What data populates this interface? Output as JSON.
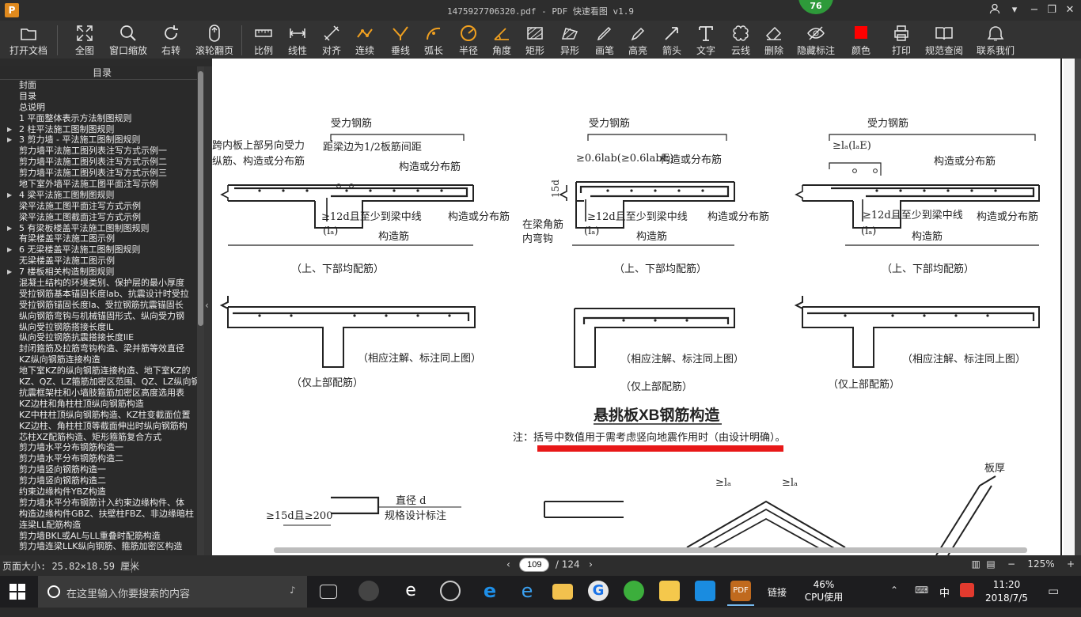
{
  "window": {
    "title": "1475927706320.pdf - PDF 快速看图 v1.9",
    "logo_letter": "P",
    "badge": "76"
  },
  "toolbar": [
    {
      "label": "打开文档",
      "icon": "folder-icon"
    },
    {
      "label": "全图",
      "icon": "fullscreen-icon"
    },
    {
      "label": "窗口缩放",
      "icon": "magnifier-icon"
    },
    {
      "label": "右转",
      "icon": "rotate-right-icon"
    },
    {
      "label": "滚轮翻页",
      "icon": "mouse-wheel-icon"
    },
    {
      "label": "比例",
      "icon": "scale-ruler-icon"
    },
    {
      "label": "线性",
      "icon": "linear-dimension-icon"
    },
    {
      "label": "对齐",
      "icon": "aligned-dimension-icon"
    },
    {
      "label": "连续",
      "icon": "continuous-dimension-icon"
    },
    {
      "label": "垂线",
      "icon": "perpendicular-icon"
    },
    {
      "label": "弧长",
      "icon": "arc-length-icon"
    },
    {
      "label": "半径",
      "icon": "radius-icon"
    },
    {
      "label": "角度",
      "icon": "angle-icon"
    },
    {
      "label": "矩形",
      "icon": "rectangle-area-icon"
    },
    {
      "label": "异形",
      "icon": "polygon-area-icon"
    },
    {
      "label": "画笔",
      "icon": "pen-icon"
    },
    {
      "label": "高亮",
      "icon": "highlighter-icon"
    },
    {
      "label": "箭头",
      "icon": "arrow-icon"
    },
    {
      "label": "文字",
      "icon": "text-icon"
    },
    {
      "label": "云线",
      "icon": "cloud-line-icon"
    },
    {
      "label": "删除",
      "icon": "eraser-icon"
    },
    {
      "label": "隐藏标注",
      "icon": "hide-eye-icon"
    },
    {
      "label": "颜色",
      "icon": "color-swatch-icon",
      "color": "#ff0000"
    },
    {
      "label": "打印",
      "icon": "printer-icon"
    },
    {
      "label": "规范查阅",
      "icon": "book-icon"
    },
    {
      "label": "联系我们",
      "icon": "contact-icon"
    }
  ],
  "sidebar": {
    "title": "目录",
    "items": [
      {
        "label": "封面",
        "expandable": false
      },
      {
        "label": "目录",
        "expandable": false
      },
      {
        "label": "总说明",
        "expandable": false
      },
      {
        "label": "1 平面整体表示方法制图规则",
        "expandable": false
      },
      {
        "label": "2 柱平法施工图制图规则",
        "expandable": true
      },
      {
        "label": "3 剪力墙 - 平法施工图制图规则",
        "expandable": true
      },
      {
        "label": "剪力墙平法施工图列表注写方式示例一",
        "expandable": false
      },
      {
        "label": "剪力墙平法施工图列表注写方式示例二",
        "expandable": false
      },
      {
        "label": "剪力墙平法施工图列表注写方式示例三",
        "expandable": false
      },
      {
        "label": "地下室外墙平法施工图平面注写示例",
        "expandable": false
      },
      {
        "label": "4 梁平法施工图制图规则",
        "expandable": true
      },
      {
        "label": "梁平法施工图平面注写方式示例",
        "expandable": false
      },
      {
        "label": "梁平法施工图截面注写方式示例",
        "expandable": false
      },
      {
        "label": "5 有梁板楼盖平法施工图制图规则",
        "expandable": true
      },
      {
        "label": "有梁楼盖平法施工图示例",
        "expandable": false
      },
      {
        "label": "6 无梁楼盖平法施工图制图规则",
        "expandable": true
      },
      {
        "label": "无梁楼盖平法施工图示例",
        "expandable": false
      },
      {
        "label": "7 楼板相关构造制图规则",
        "expandable": true
      },
      {
        "label": "混凝土结构的环境类别、保护层的最小厚度",
        "expandable": false
      },
      {
        "label": "受拉钢筋基本锚固长度lab、抗震设计时受拉",
        "expandable": false
      },
      {
        "label": "受拉钢筋锚固长度la、受拉钢筋抗震锚固长",
        "expandable": false
      },
      {
        "label": "纵向钢筋弯钩与机械锚固形式、纵向受力钢",
        "expandable": false
      },
      {
        "label": "纵向受拉钢筋搭接长度lL",
        "expandable": false
      },
      {
        "label": "纵向受拉钢筋抗震搭接长度llE",
        "expandable": false
      },
      {
        "label": "封闭箍筋及拉筋弯钩构造、梁并筋等效直径",
        "expandable": false
      },
      {
        "label": "KZ纵向钢筋连接构造",
        "expandable": false
      },
      {
        "label": "地下室KZ的纵向钢筋连接构造、地下室KZ的",
        "expandable": false
      },
      {
        "label": "KZ、QZ、LZ箍筋加密区范围、QZ、LZ纵向钢",
        "expandable": false
      },
      {
        "label": "抗震框架柱和小墙肢箍筋加密区高度选用表",
        "expandable": false
      },
      {
        "label": "KZ边柱和角柱柱顶纵向钢筋构造",
        "expandable": false
      },
      {
        "label": "KZ中柱柱顶纵向钢筋构造、KZ柱变截面位置",
        "expandable": false
      },
      {
        "label": "KZ边柱、角柱柱顶等截面伸出时纵向钢筋构",
        "expandable": false
      },
      {
        "label": "芯柱XZ配筋构造、矩形箍筋复合方式",
        "expandable": false
      },
      {
        "label": "剪力墙水平分布钢筋构造一",
        "expandable": false
      },
      {
        "label": "剪力墙水平分布钢筋构造二",
        "expandable": false
      },
      {
        "label": "剪力墙竖向钢筋构造一",
        "expandable": false
      },
      {
        "label": "剪力墙竖向钢筋构造二",
        "expandable": false
      },
      {
        "label": "约束边缘构件YBZ构造",
        "expandable": false
      },
      {
        "label": "剪力墙水平分布钢筋计入约束边缘构件、体",
        "expandable": false
      },
      {
        "label": "构造边缘构件GBZ、扶壁柱FBZ、非边缘暗柱",
        "expandable": false
      },
      {
        "label": "连梁LL配筋构造",
        "expandable": false
      },
      {
        "label": "剪力墙BKL或AL与LL重叠时配筋构造",
        "expandable": false
      },
      {
        "label": "剪力墙连梁LLK纵向钢筋、箍筋加密区构造",
        "expandable": false
      }
    ]
  },
  "drawing": {
    "labels": {
      "rebar_main": "受力钢筋",
      "rebar_dist": "构造或分布筋",
      "rebar_struct": "构造筋",
      "note_left_1": "跨内板上部另向受力",
      "note_left_2": "纵筋、构造或分布筋",
      "beam_edge": "距梁边为1/2板筋间距",
      "anchor_12d": "≥12d且至少到梁中线",
      "anchor_la": "(lₐ)",
      "anchor_lab": "≥0.6lab(≥0.6labE)",
      "anchor_la2": "≥lₐ(lₐE)",
      "d15": "15d",
      "corner_hook_1": "在梁角筋",
      "corner_hook_2": "内弯钩",
      "caption_both": "（上、下部均配筋）",
      "caption_top": "（仅上部配筋）",
      "caption_same": "（相应注解、标注同上图）",
      "main_title": "悬挑板XB钢筋构造",
      "note": "注：括号中数值用于需考虑竖向地震作用时（由设计明确）。",
      "diameter": "直径  d",
      "spec_label": "规格设计标注",
      "d15_200": "≥15d且≥200",
      "slab_thick": "板厚",
      "la_small": "≥lₐ"
    },
    "highlight_color": "#e81818"
  },
  "status": {
    "page_size": "页面大小: 25.82×18.59 厘米",
    "current_page": "109",
    "total_pages": "/ 124",
    "zoom": "125%"
  },
  "taskbar": {
    "search_placeholder": "在这里输入你要搜索的内容",
    "cpu_percent": "46%",
    "cpu_label": "CPU使用",
    "link_label": "链接",
    "ime": "中",
    "time": "11:20",
    "date": "2018/7/5"
  }
}
